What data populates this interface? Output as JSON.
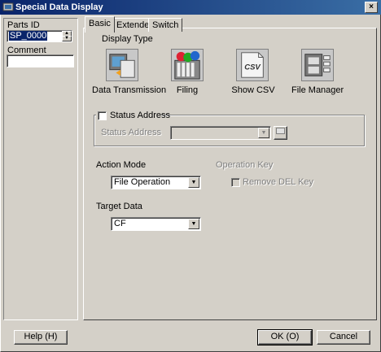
{
  "window": {
    "title": "Special Data Display",
    "close_glyph": "×"
  },
  "left_panel": {
    "parts_id_label": "Parts ID",
    "parts_id_value": "SP_0000",
    "comment_label": "Comment",
    "comment_value": ""
  },
  "tabs": [
    {
      "label": "Basic",
      "active": true
    },
    {
      "label": "Extended",
      "active": false
    },
    {
      "label": "Switch",
      "active": false
    }
  ],
  "display_type": {
    "heading": "Display Type",
    "items": [
      {
        "label": "Data Transmission",
        "icon": "data-transmission-icon"
      },
      {
        "label": "Filing",
        "icon": "filing-icon"
      },
      {
        "label": "Show CSV",
        "icon": "csv-icon",
        "icon_text": "CSV"
      },
      {
        "label": "File Manager",
        "icon": "file-manager-icon"
      }
    ]
  },
  "status_group": {
    "checkbox_label": "Status Address",
    "checked": false,
    "field_label": "Status Address",
    "field_value": ""
  },
  "action_mode": {
    "label": "Action Mode",
    "value": "File Operation"
  },
  "operation_key": {
    "label": "Operation Key",
    "checkbox_label": "Remove DEL Key",
    "checked": false
  },
  "target_data": {
    "label": "Target Data",
    "value": "CF"
  },
  "footer": {
    "help_label": "Help (H)",
    "ok_label": "OK (O)",
    "cancel_label": "Cancel"
  }
}
